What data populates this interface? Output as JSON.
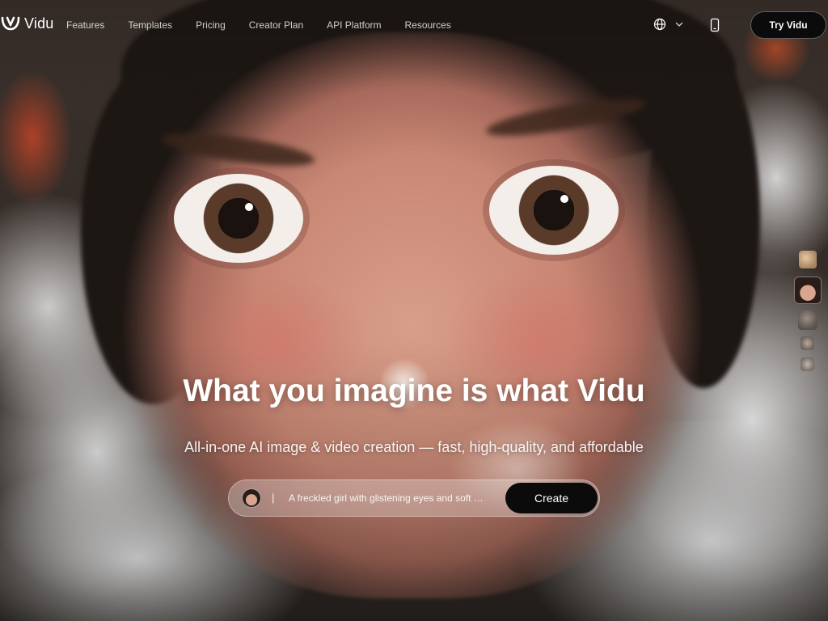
{
  "brand": {
    "name": "Vidu",
    "logo_icon": "vidu-logo-icon"
  },
  "nav": {
    "links": [
      "Features",
      "Templates",
      "Pricing",
      "Creator Plan",
      "API Platform",
      "Resources"
    ],
    "language_icon": "globe-icon",
    "language_chevron": "chevron-down-icon",
    "mobile_icon": "mobile-phone-icon",
    "cta_label": "Try Vidu"
  },
  "hero": {
    "headline": "What you imagine is what Vidu",
    "subheadline": "All-in-one AI image & video creation — fast, high-quality, and affordable"
  },
  "prompt": {
    "cursor": "|",
    "text": "A freckled girl with glistening eyes and soft …",
    "button_label": "Create"
  },
  "thumbnails": {
    "count": 5,
    "active_index": 1
  },
  "colors": {
    "button_bg": "#0b0b0b",
    "text_primary": "#ffffff"
  }
}
